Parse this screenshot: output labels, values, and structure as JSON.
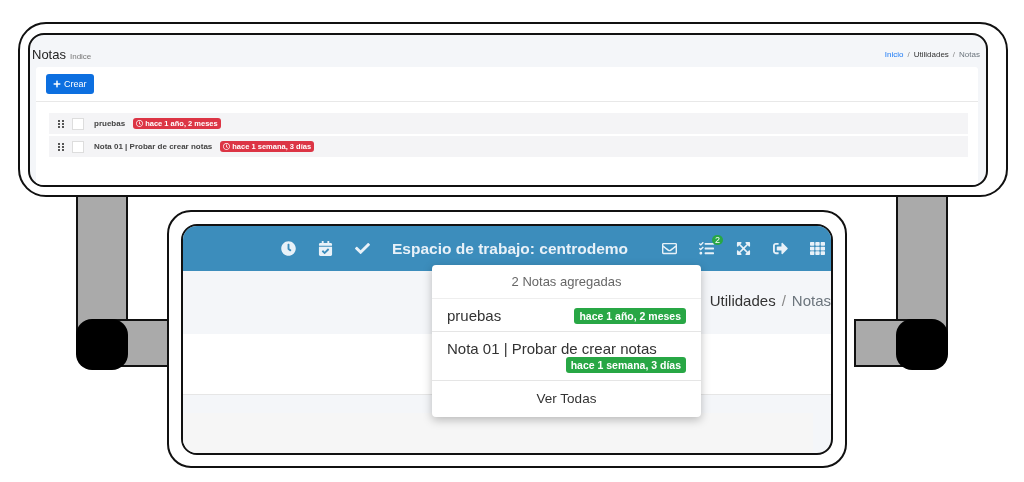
{
  "index_screen": {
    "title": "Notas",
    "subtitle": "Indice",
    "separator": "/",
    "breadcrumb": [
      {
        "label": "Inicio",
        "kind": "link"
      },
      {
        "label": "Utilidades",
        "kind": "section"
      },
      {
        "label": "Notas",
        "kind": "current"
      }
    ],
    "create_button": "Crear",
    "notes": [
      {
        "title": "pruebas",
        "age": "hace 1 año, 2 meses",
        "checked": false
      },
      {
        "title": "Nota 01 | Probar de crear notas",
        "age": "hace 1 semana, 3 días",
        "checked": false
      }
    ]
  },
  "navbar_screen": {
    "workspace": "Espacio de trabajo: centrodemo",
    "notes_badge": "2",
    "separator": "/",
    "breadcrumb": [
      {
        "label": "Utilidades",
        "kind": "section"
      },
      {
        "label": "Notas",
        "kind": "current"
      }
    ],
    "dropdown": {
      "header": "2 Notas agregadas",
      "items": [
        {
          "title": "pruebas",
          "age": "hace 1 año, 2 meses"
        },
        {
          "title": "Nota 01 | Probar de crear notas",
          "age": "hace 1 semana, 3 días"
        }
      ],
      "footer": "Ver Todas"
    }
  }
}
